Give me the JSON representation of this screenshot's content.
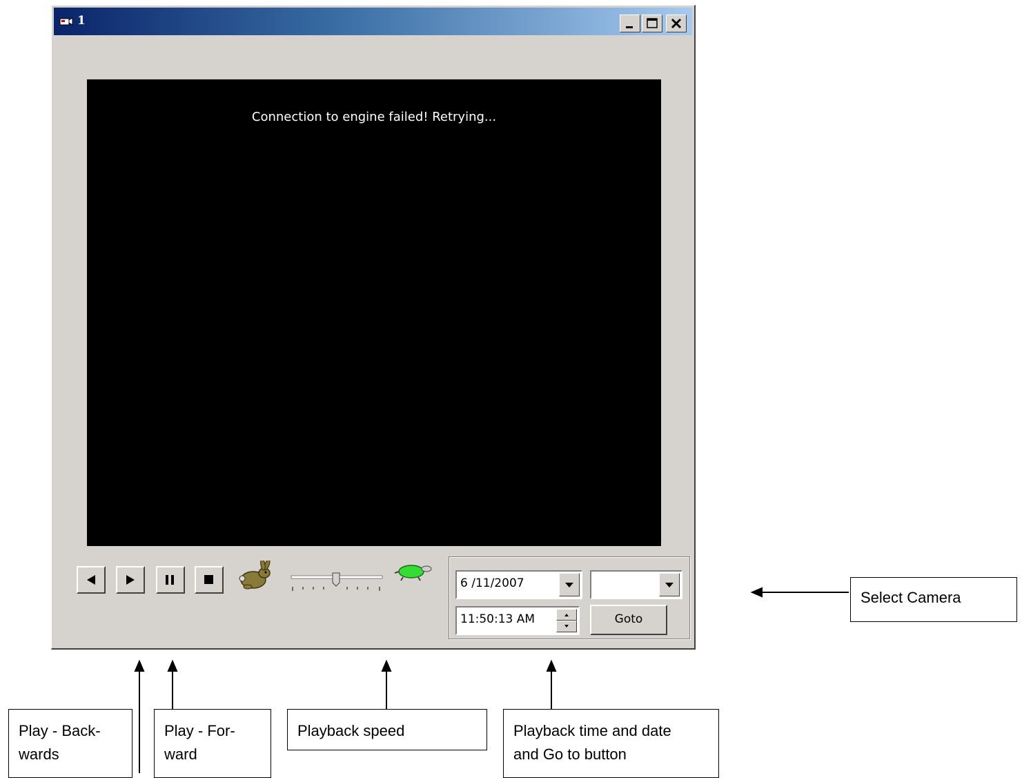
{
  "window": {
    "title": "1"
  },
  "video": {
    "message": "Connection to engine failed! Retrying..."
  },
  "controls": {
    "speed_slider_position": 0.5
  },
  "playback": {
    "date": "6 /11/2007",
    "time": "11:50:13 AM",
    "camera_selected": "",
    "goto_label": "Goto"
  },
  "annotations": {
    "play_backwards": "Play - Back-\nwards",
    "play_forward": "Play - For-\nward",
    "playback_speed": "Playback speed",
    "time_date_goto": "Playback time and date\nand Go to button",
    "select_camera": "Select Camera"
  }
}
